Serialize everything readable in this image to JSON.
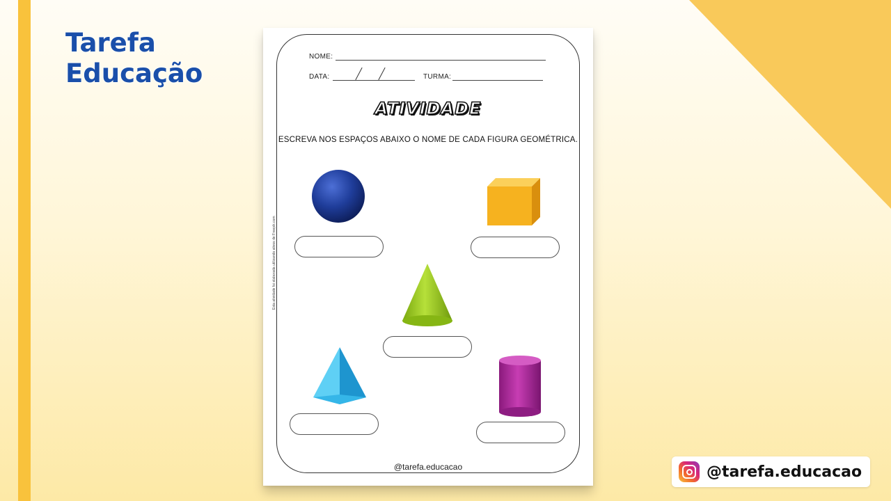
{
  "brand": {
    "line1": "Tarefa",
    "line2": "Educação",
    "color": "#1a4faa"
  },
  "worksheet": {
    "fields": {
      "name_label": "NOME:",
      "date_label": "DATA:",
      "class_label": "TURMA:"
    },
    "title": "ATIVIDADE",
    "instruction": "ESCREVA NOS ESPAÇOS ABAIXO O NOME DE CADA FIGURA GEOMÉTRICA.",
    "side_note": "Esta atividade foi elaborada utilizando ativos de Freepik.com",
    "shapes": [
      {
        "name": "sphere",
        "color": "#1f3d9a"
      },
      {
        "name": "cube",
        "color": "#f6b21f"
      },
      {
        "name": "cone",
        "color": "#9acb1e"
      },
      {
        "name": "pyramid",
        "color": "#35b6e8"
      },
      {
        "name": "cylinder",
        "color": "#b02a9e"
      }
    ],
    "footer": "@tarefa.educacao"
  },
  "social": {
    "platform_icon": "instagram-icon",
    "handle": "@tarefa.educacao"
  },
  "colors": {
    "accent_yellow": "#f9c23c",
    "corner_yellow": "#f9c95a"
  }
}
